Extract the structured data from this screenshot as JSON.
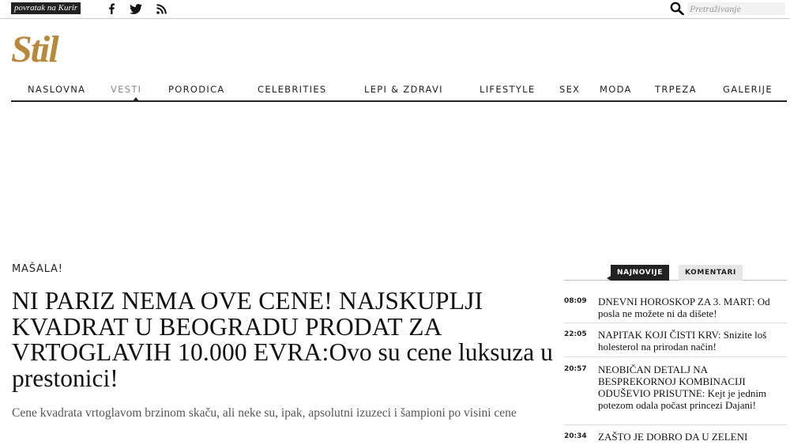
{
  "topbar": {
    "back_label": "povratak na Kurir",
    "social": [
      "facebook-icon",
      "twitter-icon",
      "rss-icon"
    ],
    "search_placeholder": "Pretraživanje"
  },
  "logo": "Stil",
  "nav": {
    "items": [
      "NASLOVNA",
      "VESTI",
      "PORODICA",
      "CELEBRITIES",
      "LEPI & ZDRAVI",
      "LIFESTYLE",
      "SEX",
      "MODA",
      "TRPEZA",
      "GALERIJE"
    ],
    "active": "VESTI"
  },
  "article": {
    "kicker": "MAŠALA!",
    "headline_upper": "NI PARIZ NEMA OVE CENE! NAJSKUPLJI KVADRAT U BEOGRADU PRODAT ZA VRTOGLAVIH 10.000 EVRA:",
    "headline_rest": "Ovo su cene luksuza u prestonici!",
    "lead": "Cene kvadrata vrtoglavom brzinom skaču, ali neke su, ipak, apsolutni izuzeci i šampioni po visini cene"
  },
  "sidebar": {
    "tabs": [
      "NAJNOVIJE",
      "KOMENTARI"
    ],
    "news": [
      {
        "time": "08:09",
        "title": "DNEVNI HOROSKOP ZA 3. MART: Od posla ne možete ni da dišete!"
      },
      {
        "time": "22:05",
        "title": "NAPITAK KOJI ČISTI KRV: Snizite loš holesterol na prirodan način!"
      },
      {
        "time": "20:57",
        "title": "NEOBIČAN DETALJ NA BESPREKORNOJ KOMBINACIJI ODUŠEVIO PRISUTNE: Kejt je jednim potezom odala počast princezi Dajani!"
      },
      {
        "time": "20:34",
        "title": "ZAŠTO JE DOBRO DA U ZELENI"
      }
    ]
  },
  "colors": {
    "logo": "#b8893a",
    "dark": "#222222"
  }
}
